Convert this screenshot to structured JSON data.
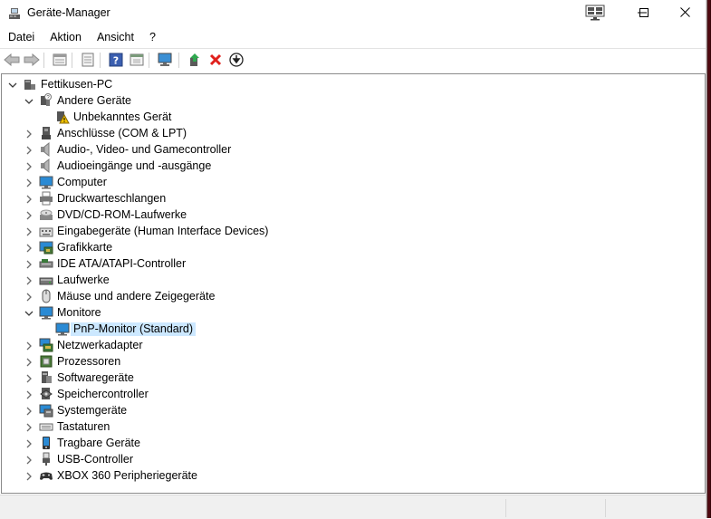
{
  "window": {
    "title": "Geräte-Manager"
  },
  "menu": {
    "items": [
      "Datei",
      "Aktion",
      "Ansicht",
      "?"
    ]
  },
  "toolbar": {
    "buttons": [
      "back-arrow-icon",
      "forward-arrow-icon",
      "properties-icon",
      "update-driver-sheet-icon",
      "help-icon",
      "view-icon",
      "scan-hardware-icon",
      "enable-device-icon",
      "uninstall-icon",
      "download-icon"
    ]
  },
  "tree": {
    "root": "Fettikusen-PC",
    "items": [
      {
        "label": "Andere Geräte",
        "expanded": true,
        "icon": "unknown-device-icon"
      },
      {
        "label": "Unbekanntes Gerät",
        "child": true,
        "icon": "warning-device-icon"
      },
      {
        "label": "Anschlüsse (COM & LPT)",
        "icon": "port-icon"
      },
      {
        "label": "Audio-, Video- und Gamecontroller",
        "icon": "speaker-icon"
      },
      {
        "label": "Audioeingänge und -ausgänge",
        "icon": "speaker-icon"
      },
      {
        "label": "Computer",
        "icon": "computer-icon"
      },
      {
        "label": "Druckwarteschlangen",
        "icon": "printer-icon"
      },
      {
        "label": "DVD/CD-ROM-Laufwerke",
        "icon": "dvd-drive-icon"
      },
      {
        "label": "Eingabegeräte (Human Interface Devices)",
        "icon": "hid-icon"
      },
      {
        "label": "Grafikkarte",
        "icon": "display-adapter-icon"
      },
      {
        "label": "IDE ATA/ATAPI-Controller",
        "icon": "ide-controller-icon"
      },
      {
        "label": "Laufwerke",
        "icon": "disk-drive-icon"
      },
      {
        "label": "Mäuse und andere Zeigegeräte",
        "icon": "mouse-icon"
      },
      {
        "label": "Monitore",
        "expanded": true,
        "icon": "monitor-icon"
      },
      {
        "label": "PnP-Monitor (Standard)",
        "child": true,
        "selected": true,
        "icon": "monitor-icon"
      },
      {
        "label": "Netzwerkadapter",
        "icon": "network-adapter-icon"
      },
      {
        "label": "Prozessoren",
        "icon": "processor-icon"
      },
      {
        "label": "Softwaregeräte",
        "icon": "software-device-icon"
      },
      {
        "label": "Speichercontroller",
        "icon": "storage-controller-icon"
      },
      {
        "label": "Systemgeräte",
        "icon": "system-device-icon"
      },
      {
        "label": "Tastaturen",
        "icon": "keyboard-icon"
      },
      {
        "label": "Tragbare Geräte",
        "icon": "portable-device-icon"
      },
      {
        "label": "USB-Controller",
        "icon": "usb-icon"
      },
      {
        "label": "XBOX 360 Peripheriegeräte",
        "icon": "gamepad-icon"
      }
    ]
  },
  "colors": {
    "selection": "#cce8ff",
    "accent": "#2a8ad4"
  }
}
